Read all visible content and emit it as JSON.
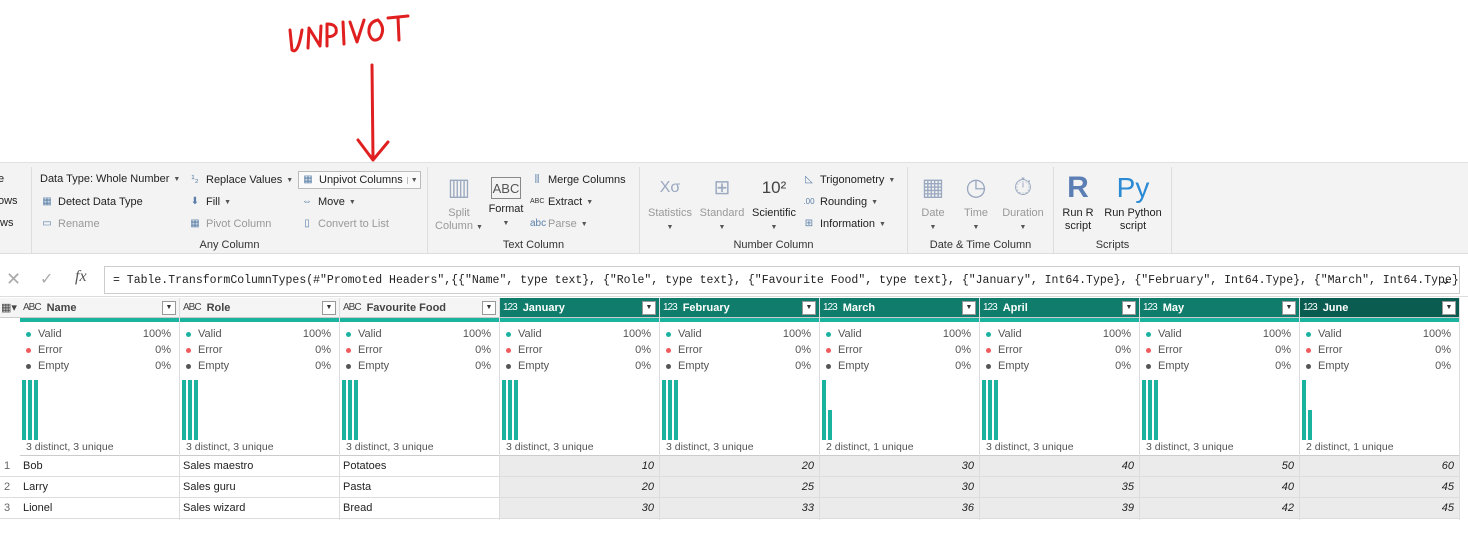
{
  "annotation": {
    "text": "UNPIVOT",
    "color": "#e02020"
  },
  "ribbon": {
    "left_partial": [
      "e",
      "ows",
      "ws"
    ],
    "any_column": {
      "label": "Any Column",
      "data_type": "Data Type: Whole Number",
      "detect": "Detect Data Type",
      "rename": "Rename",
      "replace": "Replace Values",
      "fill": "Fill",
      "pivot": "Pivot Column",
      "unpivot": "Unpivot Columns",
      "move": "Move",
      "convert": "Convert to List"
    },
    "text_column": {
      "label": "Text Column",
      "split1": "Split",
      "split2": "Column",
      "format": "Format",
      "merge": "Merge Columns",
      "extract": "Extract",
      "parse": "Parse"
    },
    "number_column": {
      "label": "Number Column",
      "statistics": "Statistics",
      "standard": "Standard",
      "scientific": "Scientific",
      "trig": "Trigonometry",
      "rounding": "Rounding",
      "information": "Information"
    },
    "datetime_column": {
      "label": "Date & Time Column",
      "date": "Date",
      "time": "Time",
      "duration": "Duration"
    },
    "scripts": {
      "label": "Scripts",
      "r1": "Run R",
      "r2": "script",
      "py1": "Run Python",
      "py2": "script"
    }
  },
  "formula": "= Table.TransformColumnTypes(#\"Promoted Headers\",{{\"Name\", type text}, {\"Role\", type text}, {\"Favourite Food\", type text}, {\"January\", Int64.Type}, {\"February\", Int64.Type}, {\"March\", Int64.Type},",
  "profile_labels": {
    "valid": "Valid",
    "error": "Error",
    "empty": "Empty"
  },
  "colors": {
    "valid": "#1bb3a0",
    "error": "#f05a5a",
    "empty": "#555555",
    "header_num": "#107c6b"
  },
  "row_numbers": [
    "1",
    "2",
    "3"
  ],
  "columns": [
    {
      "name": "Name",
      "type": "ABC",
      "valid": "100%",
      "error": "0%",
      "empty": "0%",
      "distinct": "3 distinct, 3 unique",
      "bars": [
        1,
        1,
        1
      ],
      "cells": [
        "Bob",
        "Larry",
        "Lionel"
      ]
    },
    {
      "name": "Role",
      "type": "ABC",
      "valid": "100%",
      "error": "0%",
      "empty": "0%",
      "distinct": "3 distinct, 3 unique",
      "bars": [
        1,
        1,
        1
      ],
      "cells": [
        "Sales maestro",
        "Sales guru",
        "Sales wizard"
      ]
    },
    {
      "name": "Favourite Food",
      "type": "ABC",
      "valid": "100%",
      "error": "0%",
      "empty": "0%",
      "distinct": "3 distinct, 3 unique",
      "bars": [
        1,
        1,
        1
      ],
      "cells": [
        "Potatoes",
        "Pasta",
        "Bread"
      ]
    },
    {
      "name": "January",
      "type": "123",
      "valid": "100%",
      "error": "0%",
      "empty": "0%",
      "distinct": "3 distinct, 3 unique",
      "bars": [
        1,
        1,
        1
      ],
      "cells": [
        "10",
        "20",
        "30"
      ]
    },
    {
      "name": "February",
      "type": "123",
      "valid": "100%",
      "error": "0%",
      "empty": "0%",
      "distinct": "3 distinct, 3 unique",
      "bars": [
        1,
        1,
        1
      ],
      "cells": [
        "20",
        "25",
        "33"
      ]
    },
    {
      "name": "March",
      "type": "123",
      "valid": "100%",
      "error": "0%",
      "empty": "0%",
      "distinct": "2 distinct, 1 unique",
      "bars": [
        1,
        0.5
      ],
      "cells": [
        "30",
        "30",
        "36"
      ]
    },
    {
      "name": "April",
      "type": "123",
      "valid": "100%",
      "error": "0%",
      "empty": "0%",
      "distinct": "3 distinct, 3 unique",
      "bars": [
        1,
        1,
        1
      ],
      "cells": [
        "40",
        "35",
        "39"
      ]
    },
    {
      "name": "May",
      "type": "123",
      "valid": "100%",
      "error": "0%",
      "empty": "0%",
      "distinct": "3 distinct, 3 unique",
      "bars": [
        1,
        1,
        1
      ],
      "cells": [
        "50",
        "40",
        "42"
      ]
    },
    {
      "name": "June",
      "type": "123",
      "valid": "100%",
      "error": "0%",
      "empty": "0%",
      "distinct": "2 distinct, 1 unique",
      "bars": [
        1,
        0.5
      ],
      "cells": [
        "60",
        "45",
        "45"
      ]
    }
  ]
}
